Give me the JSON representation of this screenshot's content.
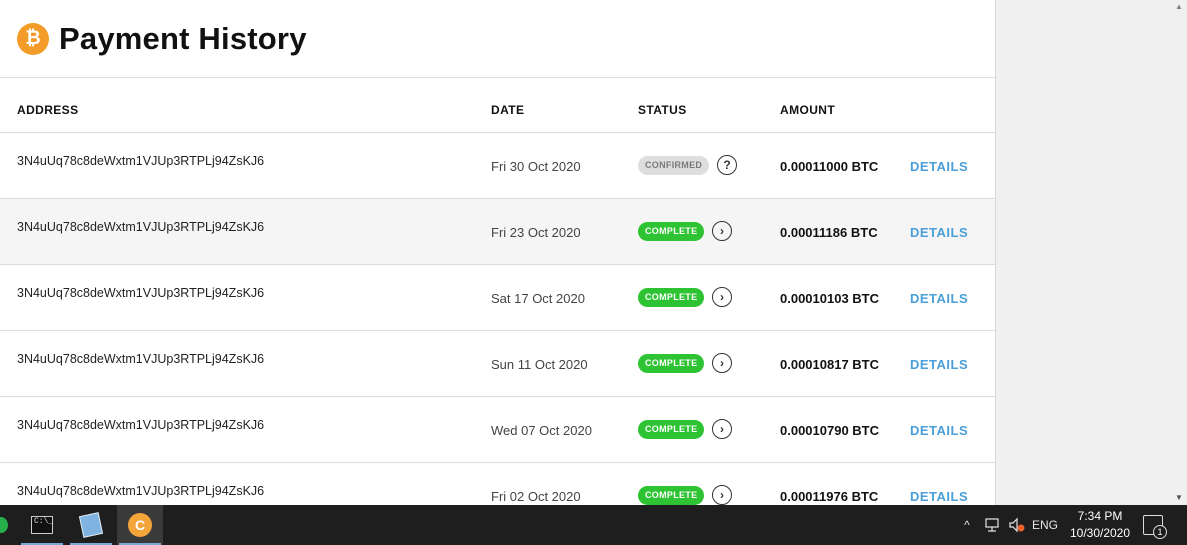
{
  "header": {
    "title": "Payment History",
    "logo_glyph": "₿"
  },
  "table": {
    "columns": [
      "ADDRESS",
      "DATE",
      "STATUS",
      "AMOUNT"
    ],
    "rows": [
      {
        "address": "3N4uUq78c8deWxtm1VJUp3RTPLj94ZsKJ6",
        "date": "Fri 30 Oct 2020",
        "status": "CONFIRMED",
        "status_icon": "?",
        "amount": "0.00011000 BTC",
        "details": "DETAILS"
      },
      {
        "address": "3N4uUq78c8deWxtm1VJUp3RTPLj94ZsKJ6",
        "date": "Fri 23 Oct 2020",
        "status": "COMPLETE",
        "status_icon": "›",
        "amount": "0.00011186 BTC",
        "details": "DETAILS"
      },
      {
        "address": "3N4uUq78c8deWxtm1VJUp3RTPLj94ZsKJ6",
        "date": "Sat 17 Oct 2020",
        "status": "COMPLETE",
        "status_icon": "›",
        "amount": "0.00010103 BTC",
        "details": "DETAILS"
      },
      {
        "address": "3N4uUq78c8deWxtm1VJUp3RTPLj94ZsKJ6",
        "date": "Sun 11 Oct 2020",
        "status": "COMPLETE",
        "status_icon": "›",
        "amount": "0.00010817 BTC",
        "details": "DETAILS"
      },
      {
        "address": "3N4uUq78c8deWxtm1VJUp3RTPLj94ZsKJ6",
        "date": "Wed 07 Oct 2020",
        "status": "COMPLETE",
        "status_icon": "›",
        "amount": "0.00010790 BTC",
        "details": "DETAILS"
      },
      {
        "address": "3N4uUq78c8deWxtm1VJUp3RTPLj94ZsKJ6",
        "date": "Fri 02 Oct 2020",
        "status": "COMPLETE",
        "status_icon": "›",
        "amount": "0.00011976 BTC",
        "details": "DETAILS"
      }
    ]
  },
  "colors": {
    "complete": "#2ec332",
    "confirmed": "#dedede",
    "details_link": "#4a9fd9",
    "btc_orange": "#f39c29"
  },
  "taskbar": {
    "apps": [
      "terminal-icon",
      "notepad-icon",
      "coin-app-icon"
    ],
    "tray": {
      "chevron": "^",
      "language": "ENG",
      "time": "7:34 PM",
      "date": "10/30/2020",
      "notification_count": "1"
    }
  }
}
